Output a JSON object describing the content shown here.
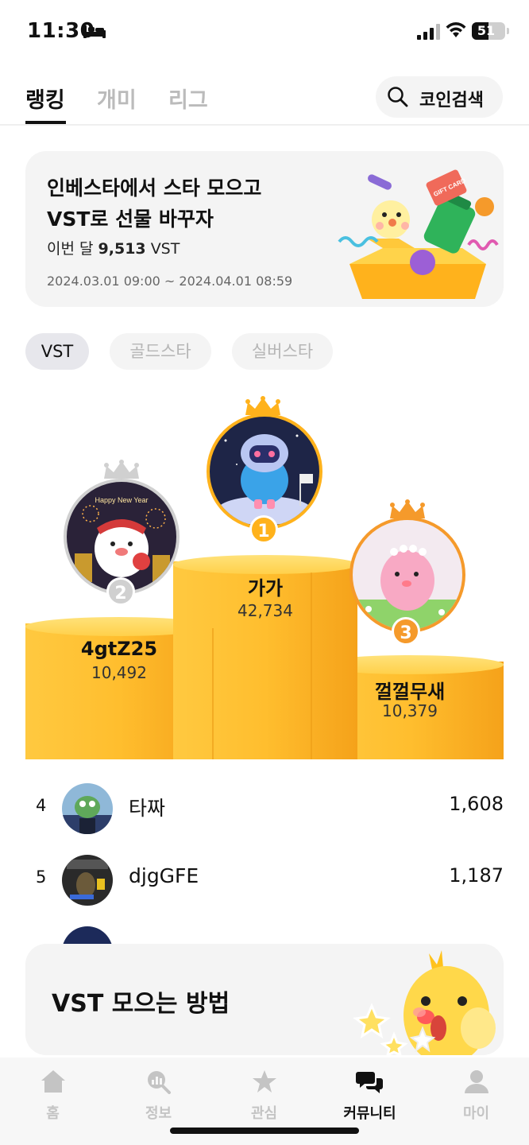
{
  "status_bar": {
    "time": "11:30",
    "battery_text": "51",
    "battery_level": 0.51
  },
  "top_tabs": {
    "items": [
      {
        "label": "랭킹",
        "active": true
      },
      {
        "label": "개미",
        "active": false
      },
      {
        "label": "리그",
        "active": false
      }
    ],
    "search_label": "코인검색"
  },
  "banner": {
    "line1": "인베스타에서 스타 모으고",
    "line2": "VST로 선물 바꾸자",
    "month_prefix": "이번 달",
    "month_amount": "9,513",
    "month_unit": "VST",
    "period": "2024.03.01 09:00 ~ 2024.04.01 08:59",
    "gift_card_text": "GIFT CARD"
  },
  "filters": [
    {
      "label": "VST",
      "active": true
    },
    {
      "label": "골드스타",
      "active": false
    },
    {
      "label": "실버스타",
      "active": false
    }
  ],
  "podium": {
    "first": {
      "rank": "1",
      "name": "가가",
      "score": "42,734"
    },
    "second": {
      "rank": "2",
      "name": "4gtZ25",
      "score": "10,492",
      "avatar_text": "Happy New Year"
    },
    "third": {
      "rank": "3",
      "name": "껄껄무새",
      "score": "10,379"
    }
  },
  "ranking_list": [
    {
      "rank": "4",
      "name": "타짜",
      "score": "1,608"
    },
    {
      "rank": "5",
      "name": "djgGFE",
      "score": "1,187"
    }
  ],
  "howto": {
    "title": "VST 모으는 방법"
  },
  "bottom_nav": [
    {
      "label": "홈",
      "icon": "home-icon",
      "active": false
    },
    {
      "label": "정보",
      "icon": "search-chart-icon",
      "active": false
    },
    {
      "label": "관심",
      "icon": "star-icon",
      "active": false
    },
    {
      "label": "커뮤니티",
      "icon": "chat-bubbles-icon",
      "active": true
    },
    {
      "label": "마이",
      "icon": "person-icon",
      "active": false
    }
  ],
  "colors": {
    "gold": "#FFB21C",
    "podium_top": "#FFD34A",
    "silver": "#D0D0D0",
    "bronze": "#F59A2B",
    "inactive_nav": "#C4C4C4"
  }
}
